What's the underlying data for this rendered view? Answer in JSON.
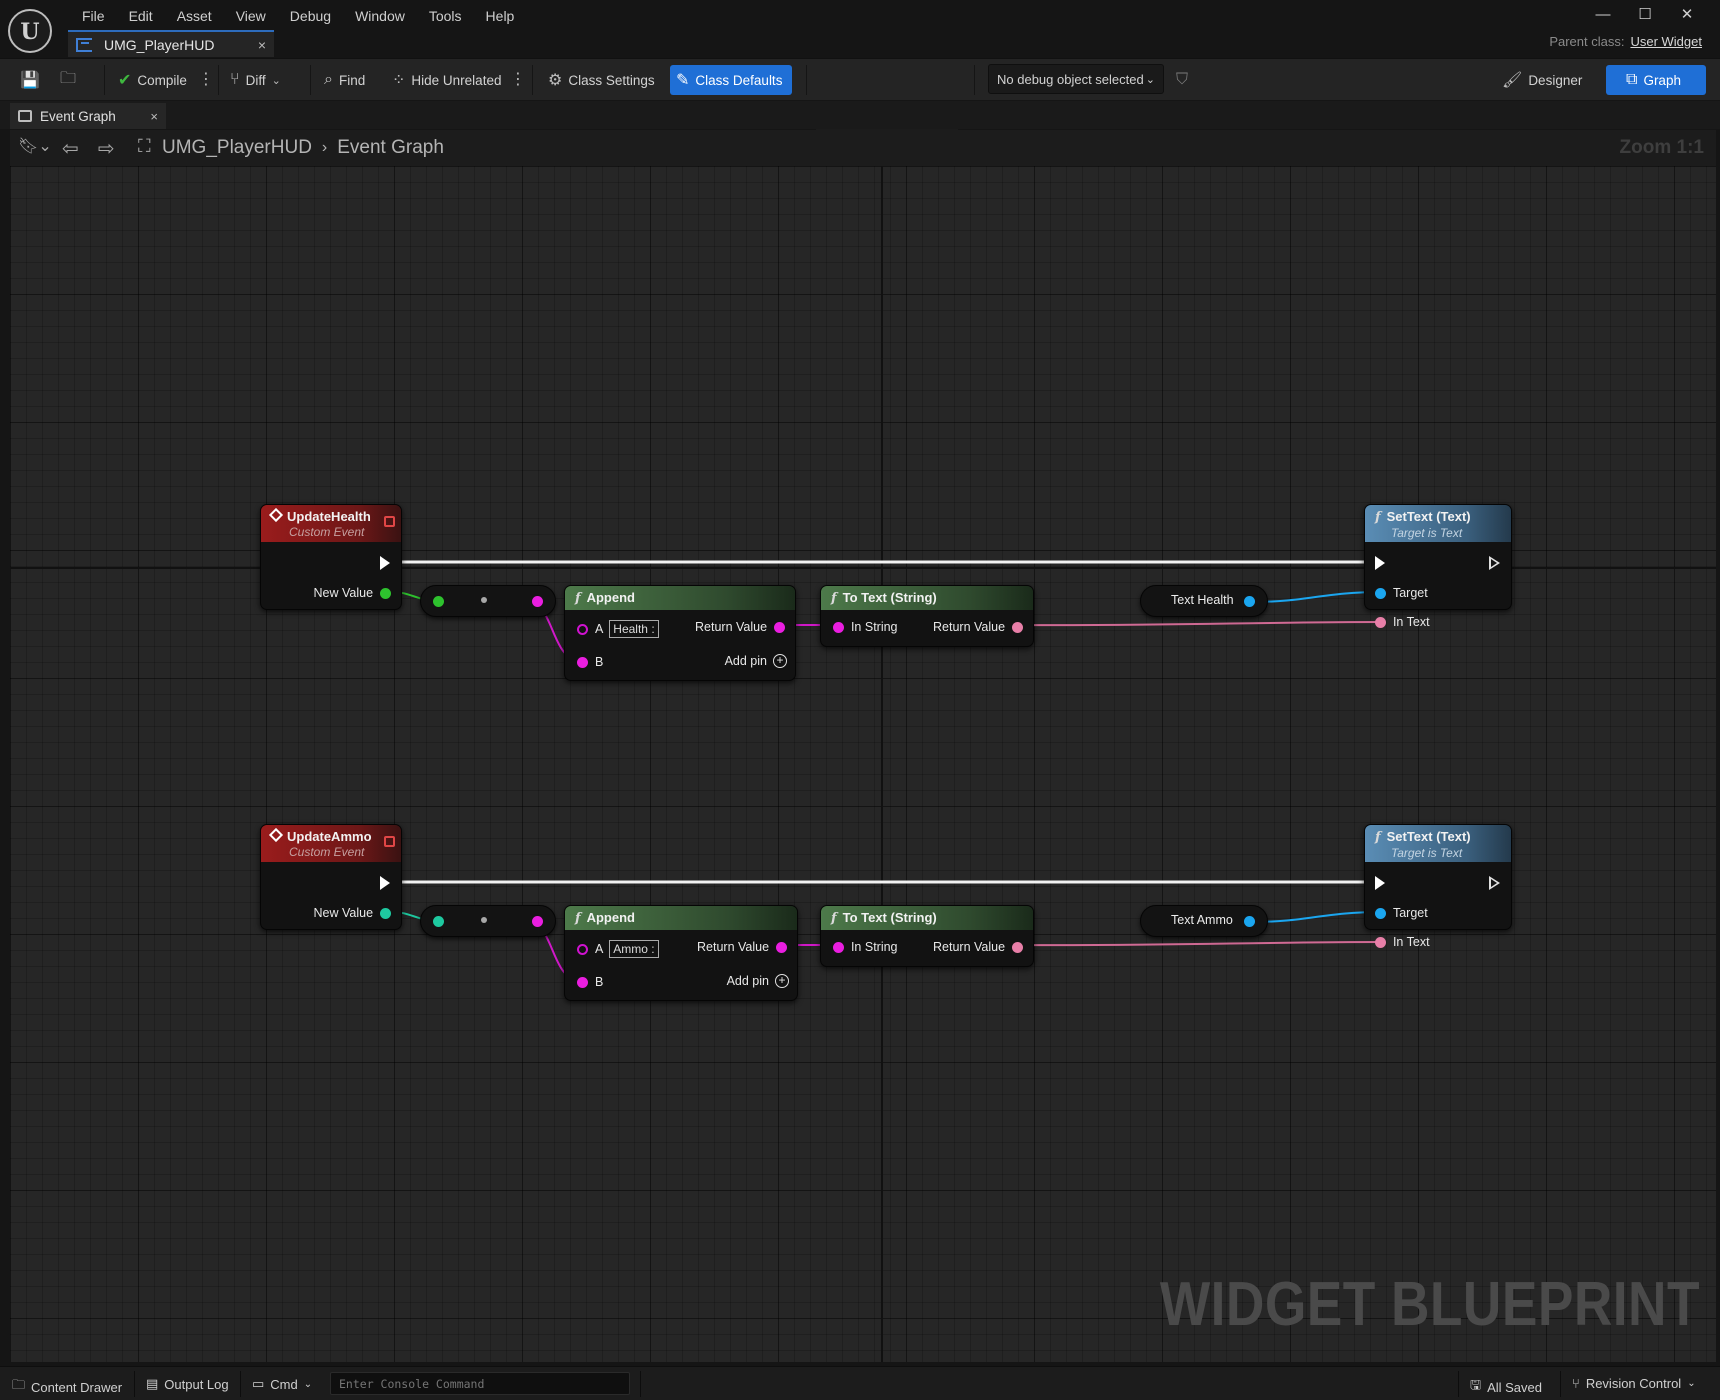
{
  "menu": [
    "File",
    "Edit",
    "Asset",
    "View",
    "Debug",
    "Window",
    "Tools",
    "Help"
  ],
  "asset_tab": {
    "label": "UMG_PlayerHUD",
    "close": "×"
  },
  "parent_class": {
    "label": "Parent class:",
    "value": "User Widget"
  },
  "window_controls": {
    "minimize": "—",
    "maximize": "☐",
    "close": "✕"
  },
  "toolbar": {
    "compile": "Compile",
    "diff": "Diff",
    "find": "Find",
    "hide_unrelated": "Hide Unrelated",
    "class_settings": "Class Settings",
    "class_defaults": "Class Defaults",
    "debug_object": "No debug object selected",
    "designer": "Designer",
    "graph": "Graph"
  },
  "graph_tab": {
    "label": "Event Graph",
    "close": "×"
  },
  "breadcrumb": {
    "root": "UMG_PlayerHUD",
    "current": "Event Graph"
  },
  "zoom": "Zoom 1:1",
  "watermark": "WIDGET BLUEPRINT",
  "nodes": {
    "update_health": {
      "title": "UpdateHealth",
      "subtitle": "Custom Event",
      "pin": "New Value"
    },
    "append_health": {
      "title": "Append",
      "a_label": "A",
      "a_value": "Health :",
      "b_label": "B",
      "return_label": "Return Value",
      "add_pin": "Add pin"
    },
    "totext_health": {
      "title": "To Text (String)",
      "in_label": "In String",
      "out_label": "Return Value"
    },
    "var_health": {
      "label": "Text Health"
    },
    "settext_health": {
      "title": "SetText (Text)",
      "subtitle": "Target is Text",
      "target": "Target",
      "in_text": "In Text"
    },
    "update_ammo": {
      "title": "UpdateAmmo",
      "subtitle": "Custom Event",
      "pin": "New Value"
    },
    "append_ammo": {
      "title": "Append",
      "a_label": "A",
      "a_value": "Ammo :",
      "b_label": "B",
      "return_label": "Return Value",
      "add_pin": "Add pin"
    },
    "totext_ammo": {
      "title": "To Text (String)",
      "in_label": "In String",
      "out_label": "Return Value"
    },
    "var_ammo": {
      "label": "Text Ammo"
    },
    "settext_ammo": {
      "title": "SetText (Text)",
      "subtitle": "Target is Text",
      "target": "Target",
      "in_text": "In Text"
    }
  },
  "pin_colors": {
    "exec": "#ffffff",
    "float": "#2ec22e",
    "int": "#1ec9a0",
    "string": "#ea1ee0",
    "text": "#e87fa8",
    "object": "#1ba6f0"
  },
  "statusbar": {
    "content_drawer": "Content Drawer",
    "output_log": "Output Log",
    "cmd": "Cmd",
    "console_placeholder": "Enter Console Command",
    "all_saved": "All Saved",
    "revision_control": "Revision Control"
  }
}
